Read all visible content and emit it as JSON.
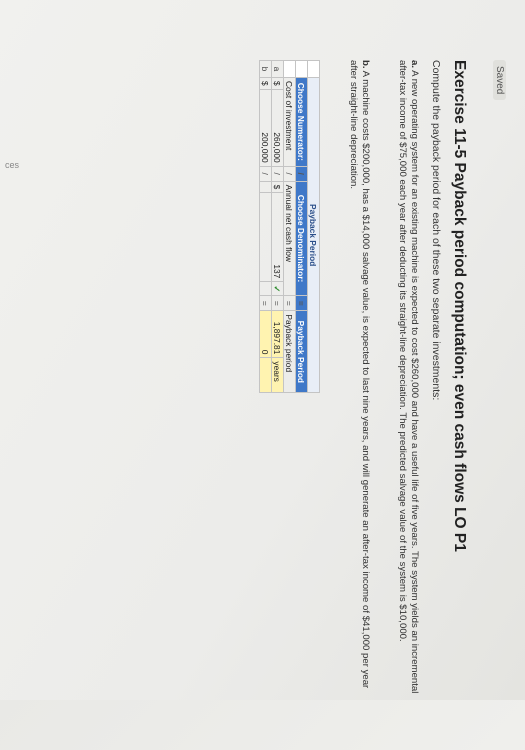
{
  "status": {
    "saved_label": "Saved"
  },
  "edge_text": "ces",
  "title": "Exercise 11-5 Payback period computation; even cash flows LO P1",
  "instructions": "Compute the payback period for each of these two separate investments:",
  "items": [
    {
      "letter": "a.",
      "text": "A new operating system for an existing machine is expected to cost $260,000 and have a useful life of five years. The system yields an incremental after-tax income of $75,000 each year after deducting its straight-line depreciation. The predicted salvage value of the system is $10,000."
    },
    {
      "letter": "b.",
      "text": "A machine costs $200,000, has a $14,000 salvage value, is expected to last nine years, and will generate an after-tax income of $41,000 per year after straight-line depreciation."
    }
  ],
  "table": {
    "title": "Payback Period",
    "headers": {
      "numerator": "Choose Numerator:",
      "slash": "/",
      "denominator": "Choose Denominator:",
      "equals": "=",
      "result": "Payback Period"
    },
    "subheaders": {
      "numerator": "Cost of investment",
      "denominator": "Annual net cash flow",
      "result": "Payback period"
    },
    "rows": [
      {
        "label": "a",
        "currency": "$",
        "numerator": "260,000",
        "slash": "/",
        "den_currency": "$",
        "denominator": "137",
        "check": "✓",
        "equals": "=",
        "result": "1,897.81",
        "unit": "years"
      },
      {
        "label": "b",
        "currency": "$",
        "numerator": "200,000",
        "slash": "/",
        "den_currency": "",
        "denominator": "",
        "check": "",
        "equals": "=",
        "result": "0",
        "unit": ""
      }
    ]
  }
}
